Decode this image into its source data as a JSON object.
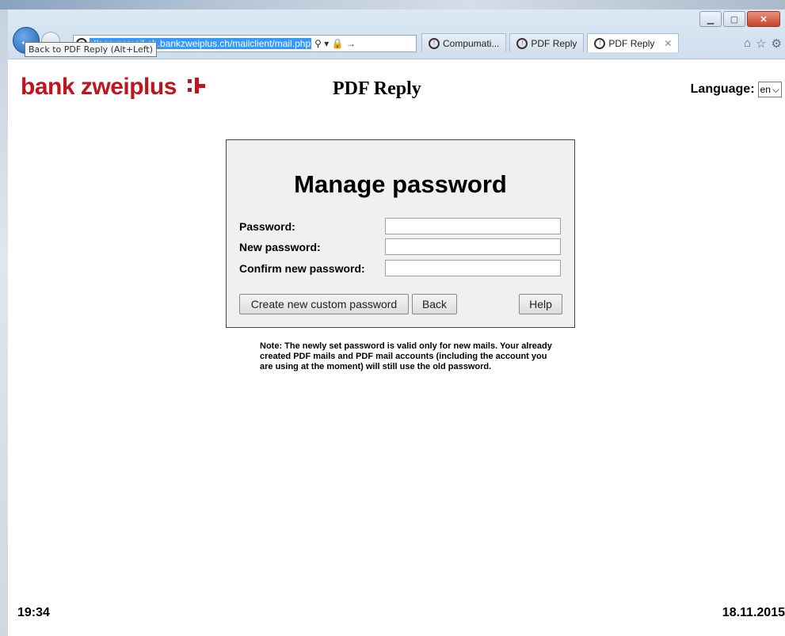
{
  "browser": {
    "url": "://securemail-ch.bankzweiplus.ch/mailclient/mail.php",
    "address_tools": "⚲ ▾ 🔒 →",
    "back_tooltip": "Back to PDF Reply (Alt+Left)",
    "tabs": [
      {
        "label": "Compumati..."
      },
      {
        "label": "PDF Reply"
      },
      {
        "label": "PDF Reply",
        "active": true
      }
    ]
  },
  "header": {
    "logo_text": "bank zweiplus",
    "title": "PDF Reply",
    "language_label": "Language:",
    "language_value": "en"
  },
  "form": {
    "title": "Manage password",
    "password_label": "Password:",
    "new_password_label": "New password:",
    "confirm_label": "Confirm new password:",
    "create_button": "Create new custom password",
    "back_button": "Back",
    "help_button": "Help"
  },
  "note": "Note: The newly set password is valid only for new mails. Your already created PDF mails and PDF mail accounts (including the account you are using at the moment) will still use the old password.",
  "footer": {
    "time": "19:34",
    "date": "18.11.2015"
  },
  "colors": {
    "brand": "#c0151f",
    "panel_bg": "#f0f0f0"
  }
}
